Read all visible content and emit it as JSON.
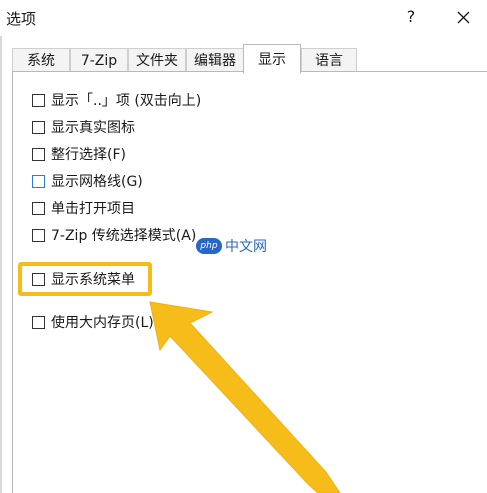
{
  "window": {
    "title": "选项",
    "help_label": "?"
  },
  "tabs": [
    {
      "label": "系统",
      "active": false
    },
    {
      "label": "7-Zip",
      "active": false
    },
    {
      "label": "文件夹",
      "active": false
    },
    {
      "label": "编辑器",
      "active": false
    },
    {
      "label": "显示",
      "active": true
    },
    {
      "label": "语言",
      "active": false
    }
  ],
  "options": [
    {
      "label": "显示「..」项 (双击向上)",
      "checked": false
    },
    {
      "label": "显示真实图标",
      "checked": false
    },
    {
      "label": "整行选择(F)",
      "checked": false
    },
    {
      "label": "显示网格线(G)",
      "checked": false
    },
    {
      "label": "单击打开项目",
      "checked": false
    },
    {
      "label": "7-Zip 传统选择模式(A)",
      "checked": false
    },
    {
      "label": "显示系统菜单",
      "checked": false
    },
    {
      "label": "使用大内存页(L)",
      "checked": false
    }
  ],
  "watermark": {
    "logo_text": "php",
    "text": "中文网"
  },
  "colors": {
    "highlight": "#f6bd1a",
    "checkbox_accent": "#2f7ad8",
    "watermark": "#2a66c8"
  }
}
